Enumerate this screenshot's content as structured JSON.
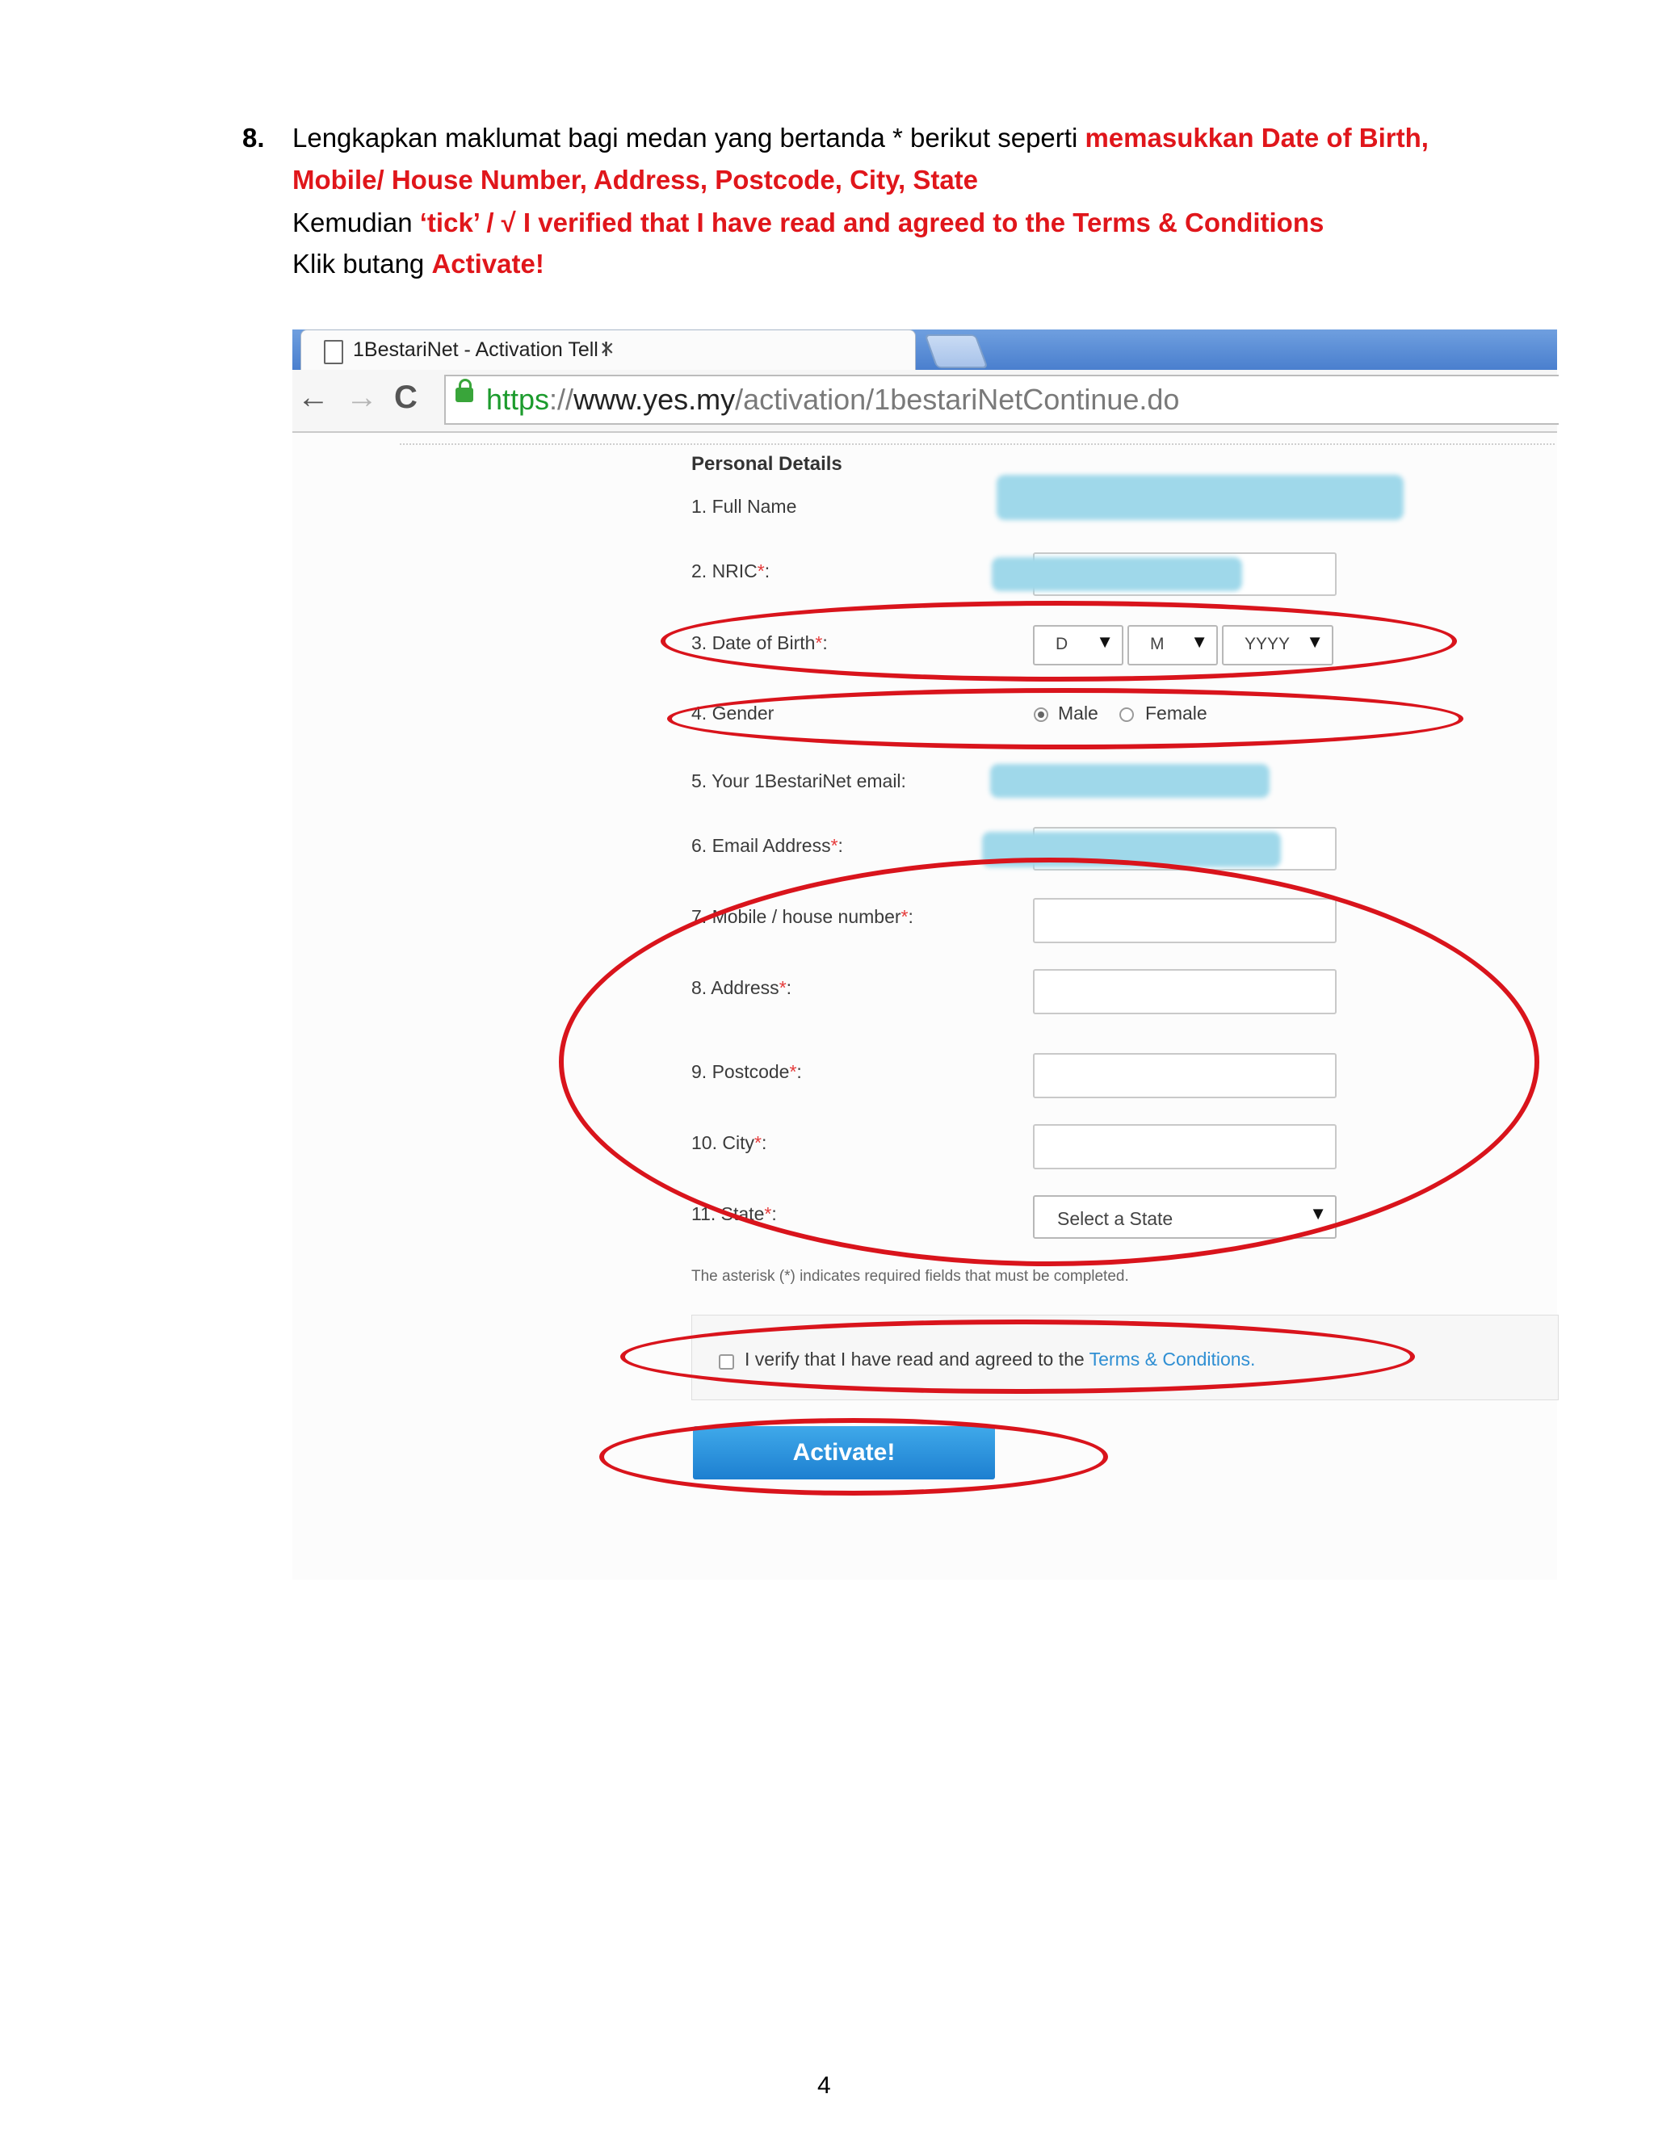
{
  "instruction": {
    "step_number": "8.",
    "line1_plain": "Lengkapkan maklumat bagi medan yang bertanda * berikut seperti ",
    "line1_red": "memasukkan Date of Birth,",
    "line2_red": "Mobile/ House Number, Address, Postcode, City, State",
    "line3_plain": "Kemudian  ",
    "line3_red_a": "‘tick’ / √  I verified that I have read and agreed to the Terms & Conditions",
    "line4_plain": "Klik butang ",
    "line4_red": "Activate!"
  },
  "browser": {
    "tab_title": "1BestariNet - Activation Tell l",
    "tab_close": "×",
    "back_icon": "←",
    "forward_icon": "→",
    "reload_icon": "C",
    "url_scheme": "https",
    "url_sep": "://",
    "url_host": "www.yes.my",
    "url_path": "/activation/1bestariNetContinue.do"
  },
  "form": {
    "section_title": "Personal Details",
    "fields": [
      {
        "label": "1.  Full Name",
        "req": ""
      },
      {
        "label": "2.  NRIC",
        "req": "*",
        "suffix": ":"
      },
      {
        "label": "3.  Date of Birth",
        "req": "*",
        "suffix": ":"
      },
      {
        "label": "4.  Gender",
        "req": ""
      },
      {
        "label": "5.  Your 1BestariNet email:",
        "req": ""
      },
      {
        "label": "6.  Email Address",
        "req": "*",
        "suffix": ":"
      },
      {
        "label": "7.  Mobile / house number",
        "req": "*",
        "suffix": ":"
      },
      {
        "label": "8.  Address",
        "req": "*",
        "suffix": ":"
      },
      {
        "label": "9.  Postcode",
        "req": "*",
        "suffix": ":"
      },
      {
        "label": "10. City",
        "req": "*",
        "suffix": ":"
      },
      {
        "label": "11.  State",
        "req": "*",
        "suffix": ":"
      }
    ],
    "dob_day": "D",
    "dob_month": "M",
    "dob_year": "YYYY",
    "gender_male": "Male",
    "gender_female": "Female",
    "gender_selected": "Male",
    "state_select": "Select a State",
    "note": "The asterisk (*) indicates required fields that must be completed.",
    "terms_text": "I verify that I have read and agreed to the ",
    "terms_link": "Terms & Conditions.",
    "activate_label": "Activate!"
  },
  "annotation_color": "#d9141c",
  "page_number": "4"
}
